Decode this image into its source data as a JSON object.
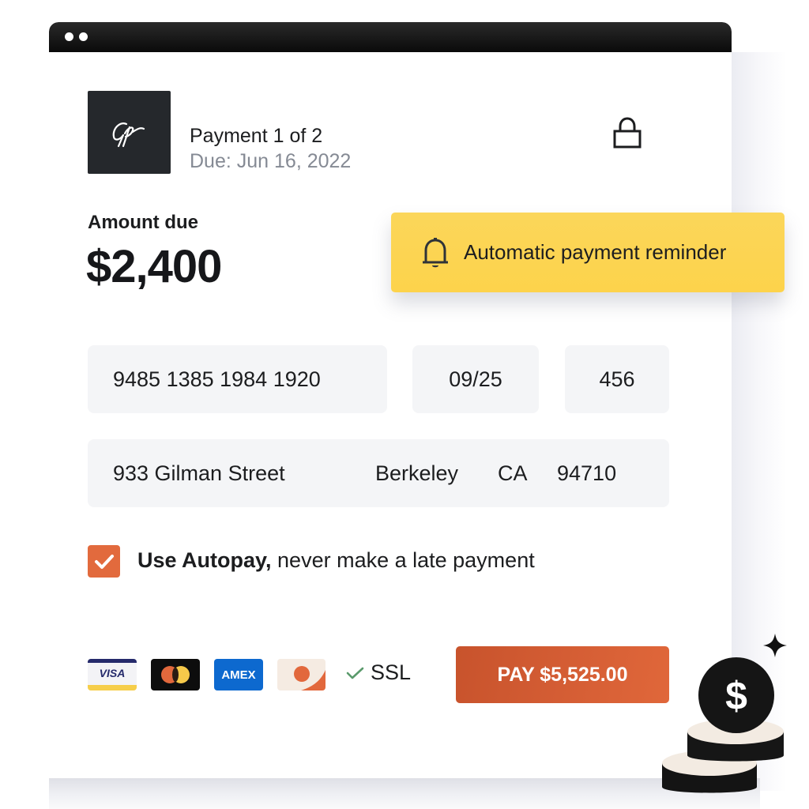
{
  "window": {
    "title_dots": 2
  },
  "header": {
    "logo_text": "Gp",
    "payment_progress": "Payment 1 of 2",
    "due_date": "Due: Jun 16, 2022",
    "lock_icon": "lock-icon"
  },
  "amount": {
    "label": "Amount due",
    "value": "$2,400"
  },
  "reminder": {
    "icon": "bell-icon",
    "text": "Automatic payment reminder"
  },
  "card_fields": {
    "card_number": "9485 1385 1984 1920",
    "expiry": "09/25",
    "cvc": "456"
  },
  "address_fields": {
    "street": "933 Gilman Street",
    "city": "Berkeley",
    "state": "CA",
    "zip": "94710"
  },
  "autopay": {
    "checked": true,
    "bold_label": "Use Autopay,",
    "label": " never make a late payment"
  },
  "payment_methods": {
    "visa": "VISA",
    "mastercard": "mastercard",
    "amex": "AMEX",
    "discover": "discover",
    "ssl_label": "SSL"
  },
  "pay_button": {
    "label": "PAY $5,525.00"
  },
  "colors": {
    "accent_orange": "#e26a3d",
    "reminder_yellow": "#fdd34b",
    "field_bg": "#f4f5f7",
    "amex_blue": "#0d69cf",
    "ssl_check_green": "#5a9a6c"
  }
}
